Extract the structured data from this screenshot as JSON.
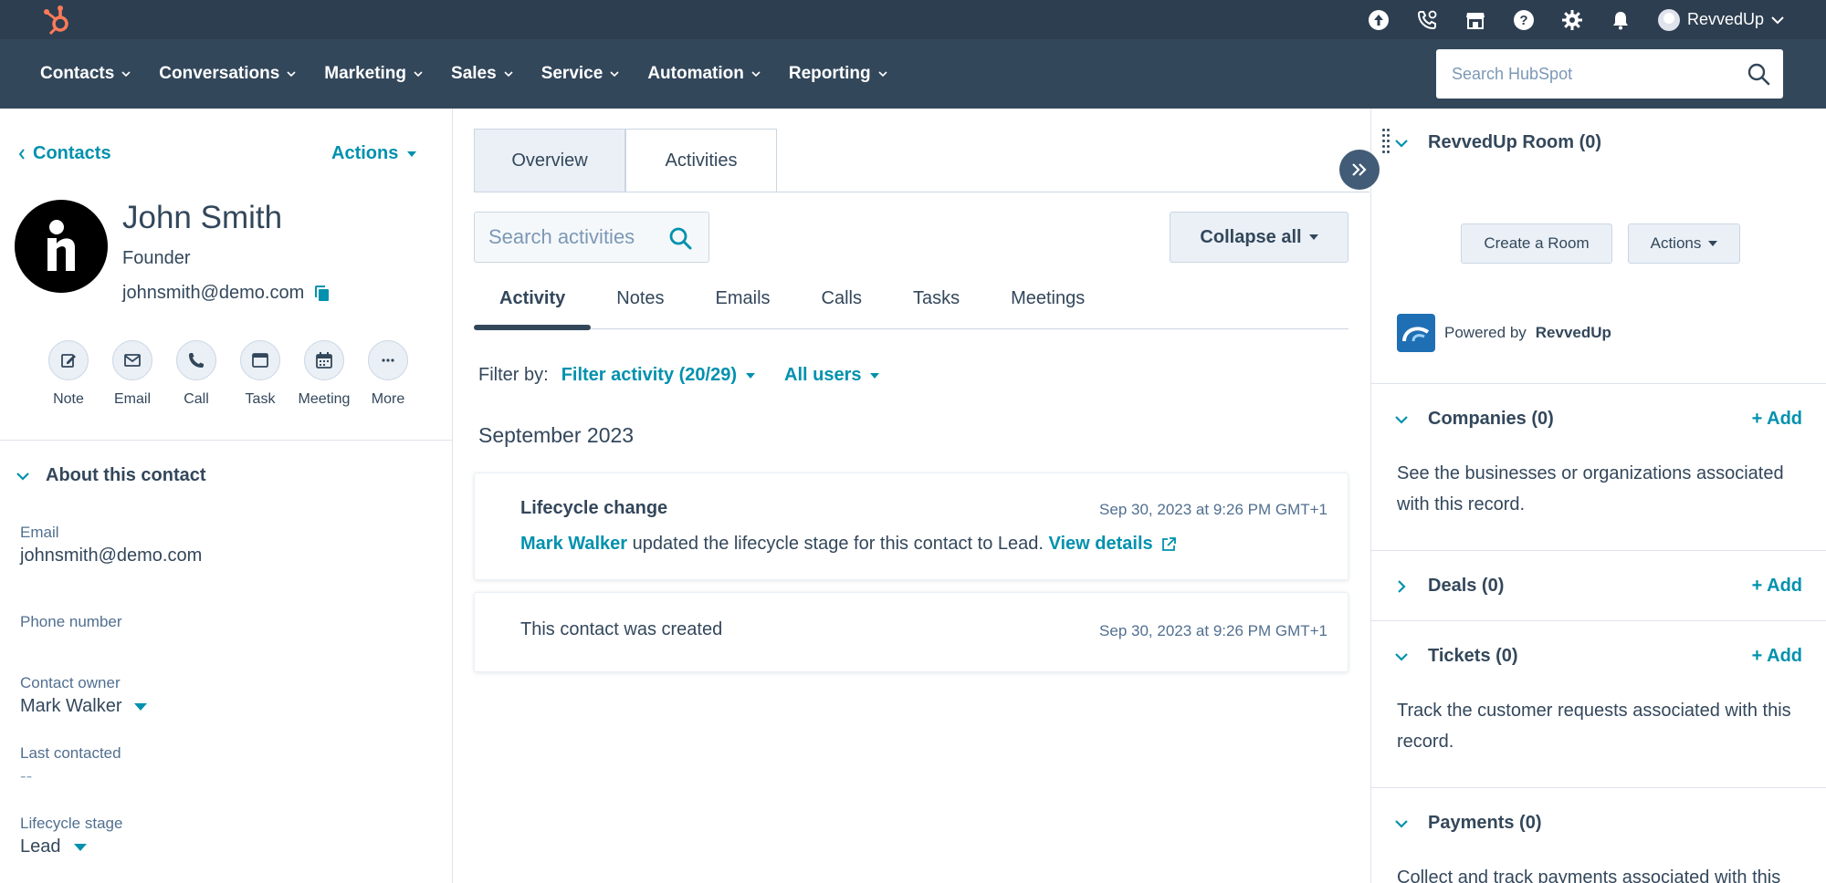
{
  "topbar": {
    "account_name": "RevvedUp",
    "icons": [
      "upgrade-icon",
      "calling-icon",
      "marketplace-icon",
      "help-icon",
      "settings-icon",
      "notifications-icon"
    ]
  },
  "nav": {
    "items": [
      {
        "label": "Contacts"
      },
      {
        "label": "Conversations"
      },
      {
        "label": "Marketing"
      },
      {
        "label": "Sales"
      },
      {
        "label": "Service"
      },
      {
        "label": "Automation"
      },
      {
        "label": "Reporting"
      }
    ],
    "search_placeholder": "Search HubSpot"
  },
  "contact": {
    "back_label": "Contacts",
    "actions_label": "Actions",
    "name": "John Smith",
    "title": "Founder",
    "email": "johnsmith@demo.com",
    "quick_actions": [
      {
        "label": "Note",
        "icon": "note-icon"
      },
      {
        "label": "Email",
        "icon": "email-icon"
      },
      {
        "label": "Call",
        "icon": "call-icon"
      },
      {
        "label": "Task",
        "icon": "task-icon"
      },
      {
        "label": "Meeting",
        "icon": "meeting-icon"
      },
      {
        "label": "More",
        "icon": "more-icon"
      }
    ],
    "about_label": "About this contact",
    "props": {
      "email_label": "Email",
      "email_value": "johnsmith@demo.com",
      "phone_label": "Phone number",
      "owner_label": "Contact owner",
      "owner_value": "Mark Walker",
      "last_contacted_label": "Last contacted",
      "last_contacted_value": "--",
      "lifecycle_label": "Lifecycle stage",
      "lifecycle_value": "Lead"
    }
  },
  "middle": {
    "tabs": [
      {
        "label": "Overview"
      },
      {
        "label": "Activities"
      }
    ],
    "active_tab": "Activities",
    "search_placeholder": "Search activities",
    "collapse_label": "Collapse all",
    "subtabs": [
      {
        "label": "Activity"
      },
      {
        "label": "Notes"
      },
      {
        "label": "Emails"
      },
      {
        "label": "Calls"
      },
      {
        "label": "Tasks"
      },
      {
        "label": "Meetings"
      }
    ],
    "filter_label": "Filter by:",
    "filter_activity": "Filter activity (20/29)",
    "filter_users": "All users",
    "month": "September 2023",
    "cards": [
      {
        "title": "Lifecycle change",
        "date": "Sep 30, 2023 at 9:26 PM GMT+1",
        "actor": "Mark Walker",
        "body": "updated the lifecycle stage for this contact to Lead.",
        "link": "View details"
      },
      {
        "title": "This contact was created",
        "date": "Sep 30, 2023 at 9:26 PM GMT+1"
      }
    ]
  },
  "right": {
    "room": {
      "title": "RevvedUp Room (0)",
      "create_label": "Create a Room",
      "actions_label": "Actions",
      "powered_prefix": "Powered by",
      "powered_brand": "RevvedUp"
    },
    "companies": {
      "title": "Companies (0)",
      "add": "+ Add",
      "desc": "See the businesses or organizations associated with this record."
    },
    "deals": {
      "title": "Deals (0)",
      "add": "+ Add"
    },
    "tickets": {
      "title": "Tickets (0)",
      "add": "+ Add",
      "desc": "Track the customer requests associated with this record."
    },
    "payments": {
      "title": "Payments (0)",
      "desc": "Collect and track payments associated with this"
    }
  },
  "colors": {
    "topbar": "#2d3e50",
    "navbar": "#33475b",
    "accent": "#0091ae",
    "brand_orange": "#ff7a59"
  }
}
